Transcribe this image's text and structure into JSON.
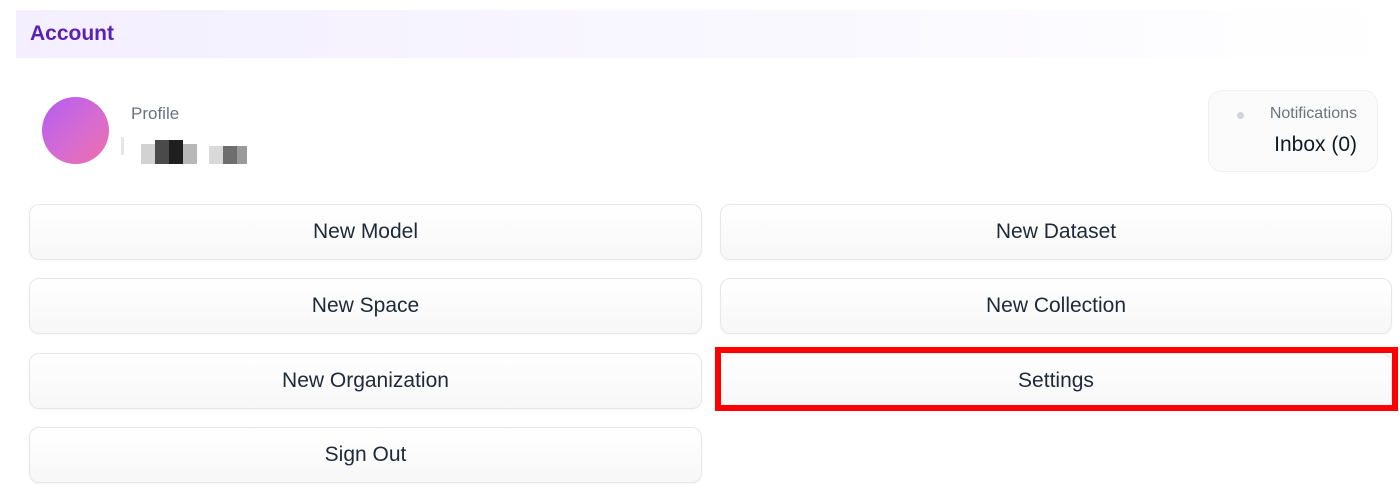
{
  "section": {
    "title": "Account"
  },
  "profile": {
    "label": "Profile",
    "avatar_colors": [
      "#b45cf2",
      "#ee6fa8"
    ]
  },
  "notifications": {
    "label": "Notifications",
    "inbox": "Inbox (0)"
  },
  "actions": {
    "new_model": "New Model",
    "new_dataset": "New Dataset",
    "new_space": "New Space",
    "new_collection": "New Collection",
    "new_organization": "New Organization",
    "settings": "Settings",
    "sign_out": "Sign Out"
  },
  "highlight": {
    "target": "settings",
    "color": "#ff0000"
  },
  "colors": {
    "accent": "#5b21b6",
    "header_bg": "#f3efff"
  }
}
